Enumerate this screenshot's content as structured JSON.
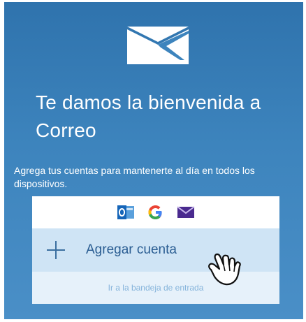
{
  "welcome": {
    "title": "Te damos la bienvenida a Correo",
    "subtitle": "Agrega tus cuentas para mantenerte al día en todos los dispositivos."
  },
  "providers": [
    {
      "name": "outlook-icon"
    },
    {
      "name": "google-icon"
    },
    {
      "name": "mail-icon"
    }
  ],
  "actions": {
    "add_account_label": "Agregar cuenta",
    "inbox_link_label": "Ir a la bandeja de entrada"
  },
  "colors": {
    "background": "#3d84bd",
    "accent": "#2a5d92",
    "row_highlight": "#cfe4f5"
  }
}
